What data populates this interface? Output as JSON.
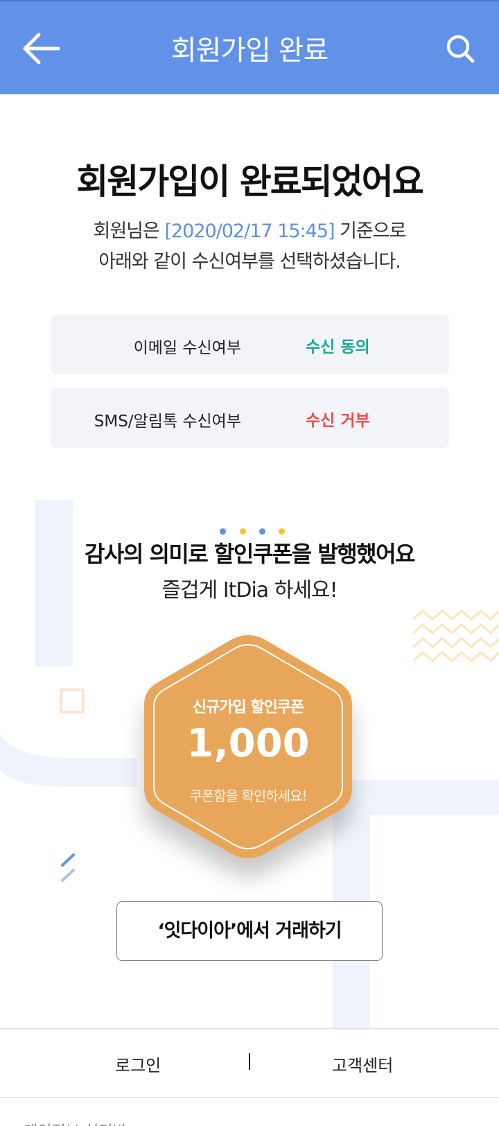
{
  "header": {
    "title": "회원가입 완료",
    "bg_color": "#6192e8"
  },
  "main": {
    "headline": "회원가입이 완료되었어요",
    "subline_prefix": "회원님은 ",
    "subline_date": "[2020/02/17 15:45]",
    "subline_suffix": " 기준으로",
    "subline_second": "아래와 같이 수신여부를 선택하셨습니다."
  },
  "consent": [
    {
      "label": "이메일 수신여부",
      "value": "수신 동의",
      "color": "#1aa89a"
    },
    {
      "label": "SMS/알림톡 수신여부",
      "value": "수신 거부",
      "color": "#f04b4b"
    }
  ],
  "thanks": {
    "line1": "감사의 의미로 할인쿠폰을 발행했어요",
    "line2": "즐겁게 ItDia 하세요!"
  },
  "coupon": {
    "title": "신규가입 할인쿠폰",
    "amount": "1,000",
    "note": "쿠폰함을 확인하세요!",
    "color": "#e8a65a"
  },
  "cta": {
    "label": "‘잇다이아’에서 거래하기"
  },
  "footer": {
    "login": "로그인",
    "support": "고객센터",
    "cut_text": "개인정보 처리방"
  },
  "icons": {
    "back": "arrow-left-icon",
    "search": "search-icon"
  }
}
